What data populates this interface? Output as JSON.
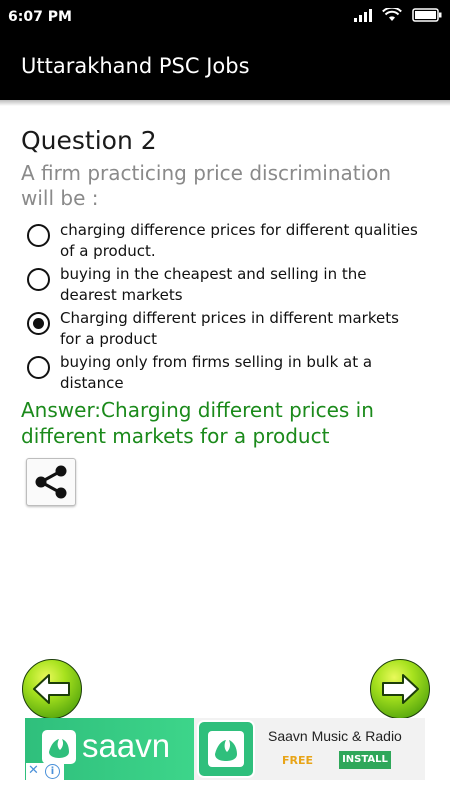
{
  "status_bar": {
    "time": "6:07 PM"
  },
  "app_bar": {
    "title": "Uttarakhand PSC Jobs"
  },
  "question": {
    "title": "Question 2",
    "text": "A firm practicing price discrimination will be :",
    "options": [
      {
        "label": "charging difference prices for different qualities of a product.",
        "selected": false
      },
      {
        "label": "buying in the cheapest and selling in the dearest markets",
        "selected": false
      },
      {
        "label": "Charging different prices in different markets for a product",
        "selected": true
      },
      {
        "label": "buying only from firms selling in bulk at a distance",
        "selected": false
      }
    ],
    "answer": "Answer:Charging different prices in different markets for a product"
  },
  "ad": {
    "brand": "saavn",
    "app_name": "Saavn Music & Radio",
    "price": "FREE",
    "install_label": "INSTALL",
    "close_symbol": "✕",
    "info_symbol": "i"
  },
  "colors": {
    "answer_green": "#1b8a1b",
    "nav_button_green": "#7fcf16",
    "ad_green": "#2fbf7c"
  }
}
